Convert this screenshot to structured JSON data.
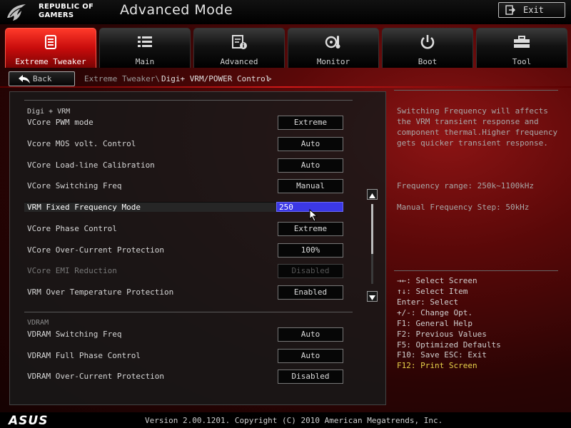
{
  "header": {
    "brand_line1": "REPUBLIC OF",
    "brand_line2": "GAMERS",
    "title": "Advanced Mode",
    "exit_label": "Exit"
  },
  "tabs": [
    {
      "label": "Extreme Tweaker",
      "icon": "extreme-tweaker-icon",
      "active": true
    },
    {
      "label": "Main",
      "icon": "list-icon",
      "active": false
    },
    {
      "label": "Advanced",
      "icon": "advanced-info-icon",
      "active": false
    },
    {
      "label": "Monitor",
      "icon": "thermometer-fan-icon",
      "active": false
    },
    {
      "label": "Boot",
      "icon": "power-icon",
      "active": false
    },
    {
      "label": "Tool",
      "icon": "toolbox-icon",
      "active": false
    }
  ],
  "breadcrumb": {
    "back_label": "Back",
    "path_parent": "Extreme Tweaker\\",
    "path_current": "Digi+ VRM/POWER Control",
    "arrow": ">"
  },
  "settings": {
    "section1_label": "Digi + VRM",
    "section2_label": "VDRAM",
    "rows": [
      {
        "label": "VCore PWM mode",
        "value": "Extreme"
      },
      {
        "label": "Vcore MOS volt. Control",
        "value": "Auto"
      },
      {
        "label": "VCore Load-line Calibration",
        "value": "Auto"
      },
      {
        "label": "VCore Switching Freq",
        "value": "Manual"
      },
      {
        "label": "VRM Fixed Frequency Mode",
        "value": "250"
      },
      {
        "label": "VCore Phase Control",
        "value": "Extreme"
      },
      {
        "label": "VCore Over-Current Protection",
        "value": "100%"
      },
      {
        "label": "VCore EMI Reduction",
        "value": "Disabled"
      },
      {
        "label": "VRM Over Temperature Protection",
        "value": "Enabled"
      },
      {
        "label": "VDRAM Switching Freq",
        "value": "Auto"
      },
      {
        "label": "VDRAM Full Phase Control",
        "value": "Auto"
      },
      {
        "label": "VDRAM Over-Current Protection",
        "value": "Disabled"
      }
    ]
  },
  "help": {
    "description": "Switching Frequency will affects the VRM transient response and component thermal.Higher frequency gets quicker transient response.",
    "range_line": "Frequency range: 250k~1100kHz",
    "step_line": "Manual Frequency Step: 50kHz"
  },
  "keys": [
    "→←: Select Screen",
    "↑↓: Select Item",
    "Enter: Select",
    "+/-: Change Opt.",
    "F1: General Help",
    "F2: Previous Values",
    "F5: Optimized Defaults",
    "F10: Save  ESC: Exit",
    "F12: Print Screen"
  ],
  "footer": {
    "brand": "ASUS",
    "version": "Version 2.00.1201. Copyright (C) 2010 American Megatrends, Inc."
  },
  "colors": {
    "accent_red": "#d01818",
    "selected_input": "#3b38e6",
    "key_highlight": "#e8d24a"
  }
}
